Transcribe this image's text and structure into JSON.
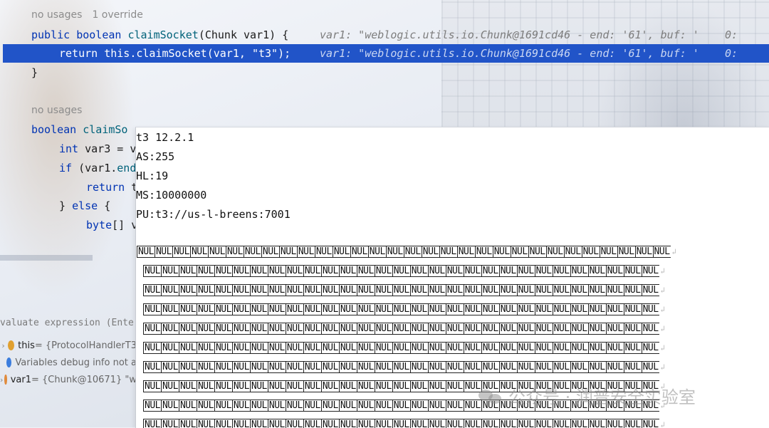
{
  "editor": {
    "method1_meta": {
      "usages": "no usages",
      "override": "1 override"
    },
    "method1_sig": {
      "kw1": "public",
      "kw2": "boolean",
      "name": "claimSocket",
      "params": "(Chunk var1) {"
    },
    "method1_hint": "var1: \"weblogic.utils.io.Chunk@1691cd46 - end: '61', buf: '    0: ",
    "exec_line": {
      "kw": "return",
      "code_a": " this.",
      "fn": "claimSocket",
      "code_b": "(var1, ",
      "str": "\"t3\"",
      "code_c": ");"
    },
    "exec_hint": "var1: \"weblogic.utils.io.Chunk@1691cd46 - end: '61', buf: '    0: ",
    "close_brace": "}",
    "method2_meta": "no usages",
    "method2_sig": {
      "kw": "boolean",
      "name": "claimSo"
    },
    "line_var3": {
      "kw": "int",
      "code": " var3 = v"
    },
    "line_if": {
      "kw": "if",
      "code": " (var1.",
      "fn": "end"
    },
    "line_return": {
      "kw": "return",
      "code": " t"
    },
    "line_else": {
      "code_a": "} ",
      "kw": "else",
      "code_b": " {"
    },
    "line_byte": {
      "kw": "byte",
      "code": "[] v"
    }
  },
  "debugger": {
    "eval_placeholder": "valuate expression (Enter",
    "variables": [
      {
        "name": "this",
        "value": " = {ProtocolHandlerT3",
        "icon": "field-icon",
        "color": "#e0a030"
      },
      {
        "name": "",
        "value": "Variables debug info not a",
        "icon": "info-icon",
        "color": "#3b7ddd"
      },
      {
        "name": "var1",
        "value": " = {Chunk@10671} \"w",
        "icon": "param-icon",
        "color": "#e08a3c"
      }
    ]
  },
  "popup": {
    "lines": [
      "t3 12.2.1",
      "AS:255",
      "HL:19",
      "MS:10000000",
      "PU:t3://us-l-breens:7001"
    ],
    "nul_token": "NUL",
    "wrap_glyph": "↲"
  },
  "watermark": {
    "text": "公众号 · 润普安全实验室"
  }
}
